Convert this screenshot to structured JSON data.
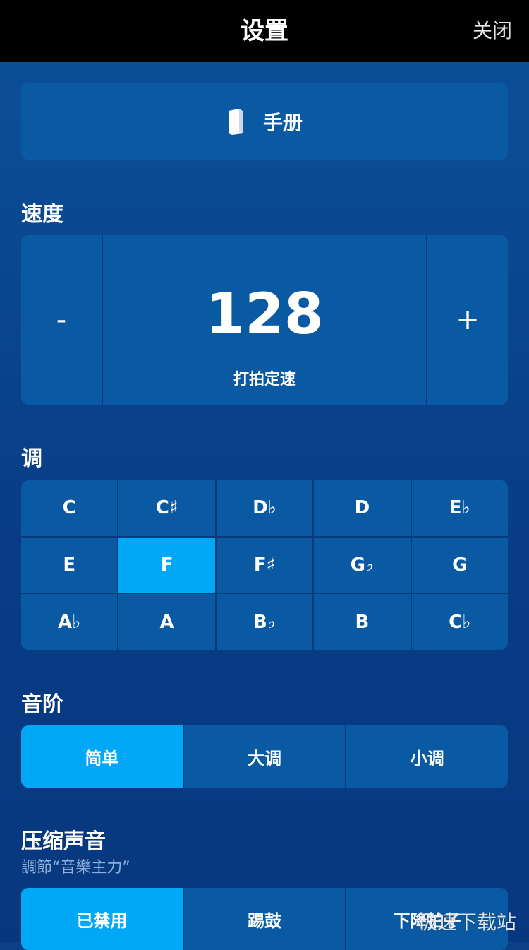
{
  "header": {
    "title": "设置",
    "close_label": "关闭"
  },
  "manual": {
    "label": "手册",
    "icon": "book-icon"
  },
  "tempo": {
    "section_label": "速度",
    "decrease_label": "-",
    "value": "128",
    "tap_label": "打拍定速",
    "increase_label": "+"
  },
  "keys": {
    "section_label": "调",
    "items": [
      "C",
      "C♯",
      "D♭",
      "D",
      "E♭",
      "E",
      "F",
      "F♯",
      "G♭",
      "G",
      "A♭",
      "A",
      "B♭",
      "B",
      "C♭"
    ],
    "selected": "F"
  },
  "scale": {
    "section_label": "音阶",
    "options": [
      "简单",
      "大调",
      "小调"
    ],
    "selected": "简单"
  },
  "compression": {
    "section_label": "压缩声音",
    "sub_label": "調節“音樂主力”",
    "options": [
      "已禁用",
      "踢鼓",
      "下降拍子"
    ],
    "selected": "已禁用"
  },
  "watermark": "极速下载站",
  "colors": {
    "selected": "#00a8f5",
    "panel": "#0a5aa3",
    "background": "#0b3f86"
  }
}
